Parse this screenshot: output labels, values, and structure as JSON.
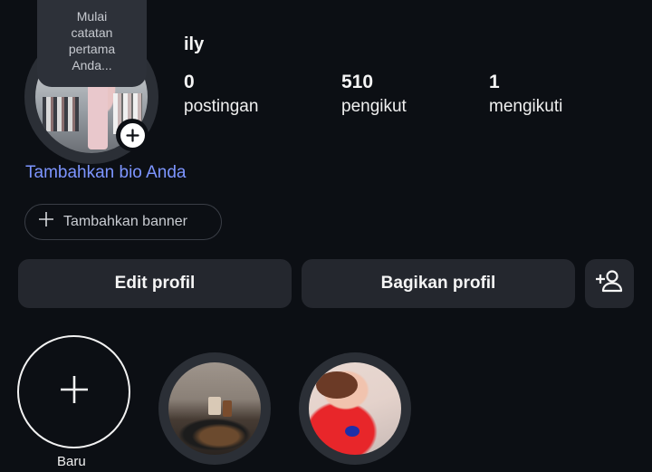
{
  "profile": {
    "note_lines": [
      "Mulai",
      "catatan",
      "pertama",
      "Anda..."
    ],
    "username": "ily",
    "bio_prompt": "Tambahkan bio Anda",
    "banner_label": "Tambahkan banner"
  },
  "stats": [
    {
      "value": "0",
      "label": "postingan"
    },
    {
      "value": "510",
      "label": "pengikut"
    },
    {
      "value": "1",
      "label": "mengikuti"
    }
  ],
  "actions": {
    "edit_label": "Edit profil",
    "share_label": "Bagikan profil",
    "add_person_icon": "add-person-icon"
  },
  "highlights": {
    "new_label": "Baru",
    "items_count_visible": 2
  },
  "colors": {
    "background": "#0c0f14",
    "button": "#24272e",
    "link": "#7d95ff"
  }
}
